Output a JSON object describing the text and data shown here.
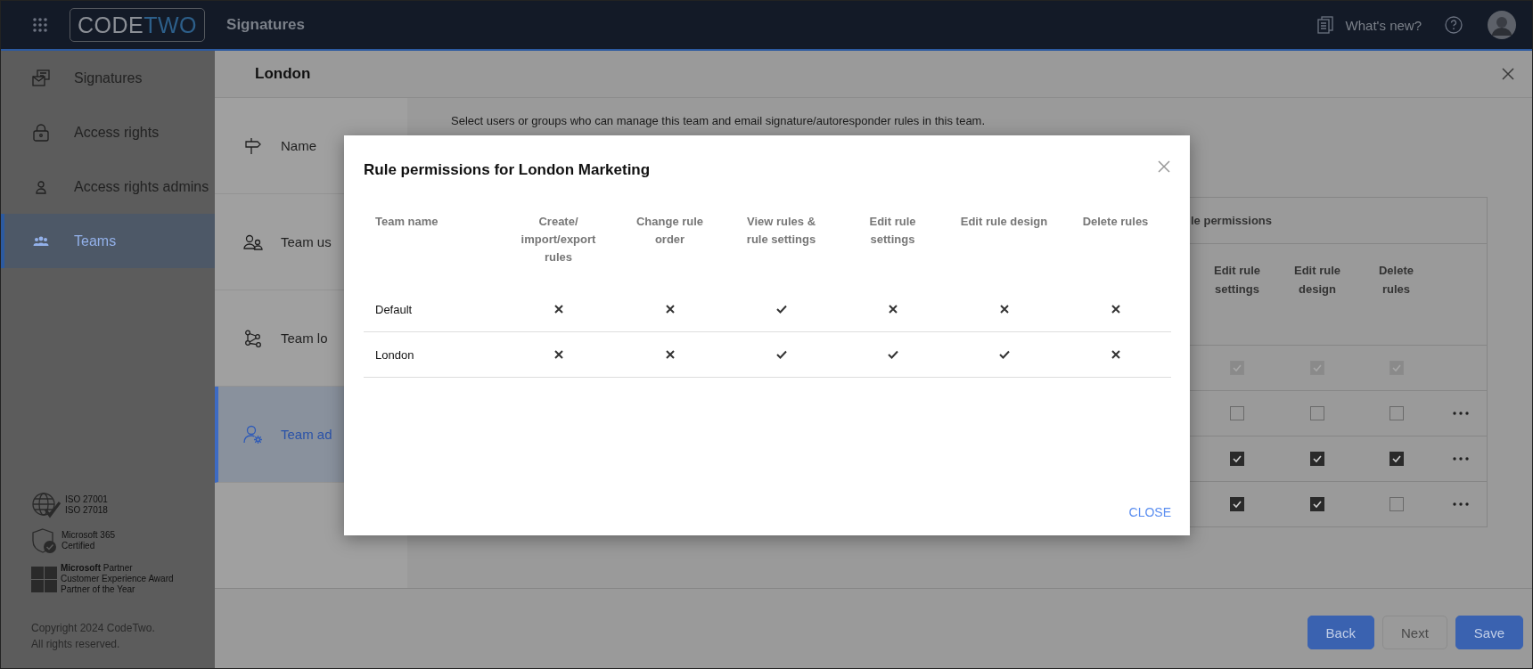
{
  "header": {
    "logo_main": "CODE",
    "logo_accent": "TWO",
    "app_title": "Signatures",
    "whats_new": "What's new?"
  },
  "sidebar": {
    "items": [
      {
        "label": "Signatures",
        "selected": false
      },
      {
        "label": "Access rights",
        "selected": false
      },
      {
        "label": "Access rights admins",
        "selected": false
      },
      {
        "label": "Teams",
        "selected": true
      }
    ],
    "badges": [
      {
        "kind": "iso",
        "lines": [
          "ISO 27001",
          "ISO 27018"
        ]
      },
      {
        "kind": "shield",
        "lines": [
          "Microsoft 365",
          "Certified"
        ]
      },
      {
        "kind": "partner",
        "lines": [
          "**Microsoft** Partner",
          "Customer Experience Award",
          "Partner of the Year"
        ]
      }
    ],
    "copyright": [
      "Copyright 2024 CodeTwo.",
      "All rights reserved."
    ]
  },
  "panel": {
    "title": "London",
    "steps": [
      {
        "label": "Name",
        "selected": false
      },
      {
        "label": "Team us",
        "selected": false
      },
      {
        "label": "Team lo",
        "selected": false
      },
      {
        "label": "Team ad",
        "selected": true
      }
    ],
    "intro": "Select users or groups who can manage this team and email signature/autoresponder rules in this team.",
    "permissions_table": {
      "group_header": "le permissions",
      "columns": [
        "Edit rule settings",
        "Edit rule design",
        "Delete rules"
      ],
      "rows": [
        {
          "cells": [
            {
              "checked": true,
              "disabled": true
            },
            {
              "checked": true,
              "disabled": true
            },
            {
              "checked": true,
              "disabled": true
            }
          ],
          "menu": false
        },
        {
          "cells": [
            {
              "checked": false,
              "disabled": false
            },
            {
              "checked": false,
              "disabled": false
            },
            {
              "checked": false,
              "disabled": false
            }
          ],
          "menu": true
        },
        {
          "cells": [
            {
              "checked": true,
              "disabled": false
            },
            {
              "checked": true,
              "disabled": false
            },
            {
              "checked": true,
              "disabled": false
            }
          ],
          "menu": true
        },
        {
          "cells": [
            {
              "checked": true,
              "disabled": false
            },
            {
              "checked": true,
              "disabled": false
            },
            {
              "checked": false,
              "disabled": false
            }
          ],
          "menu": true
        }
      ]
    },
    "buttons": [
      {
        "label": "Back",
        "disabled": false
      },
      {
        "label": "Next",
        "disabled": true
      },
      {
        "label": "Save",
        "disabled": false
      }
    ]
  },
  "dialog": {
    "title": "Rule permissions for London Marketing",
    "columns": [
      "Team name",
      "Create/ import/export rules",
      "Change rule order",
      "View rules & rule settings",
      "Edit rule settings",
      "Edit rule design",
      "Delete rules"
    ],
    "rows": [
      {
        "team": "Default",
        "permissions": [
          false,
          false,
          true,
          false,
          false,
          false
        ]
      },
      {
        "team": "London",
        "permissions": [
          false,
          false,
          true,
          true,
          true,
          false
        ]
      }
    ],
    "close_label": "CLOSE"
  }
}
